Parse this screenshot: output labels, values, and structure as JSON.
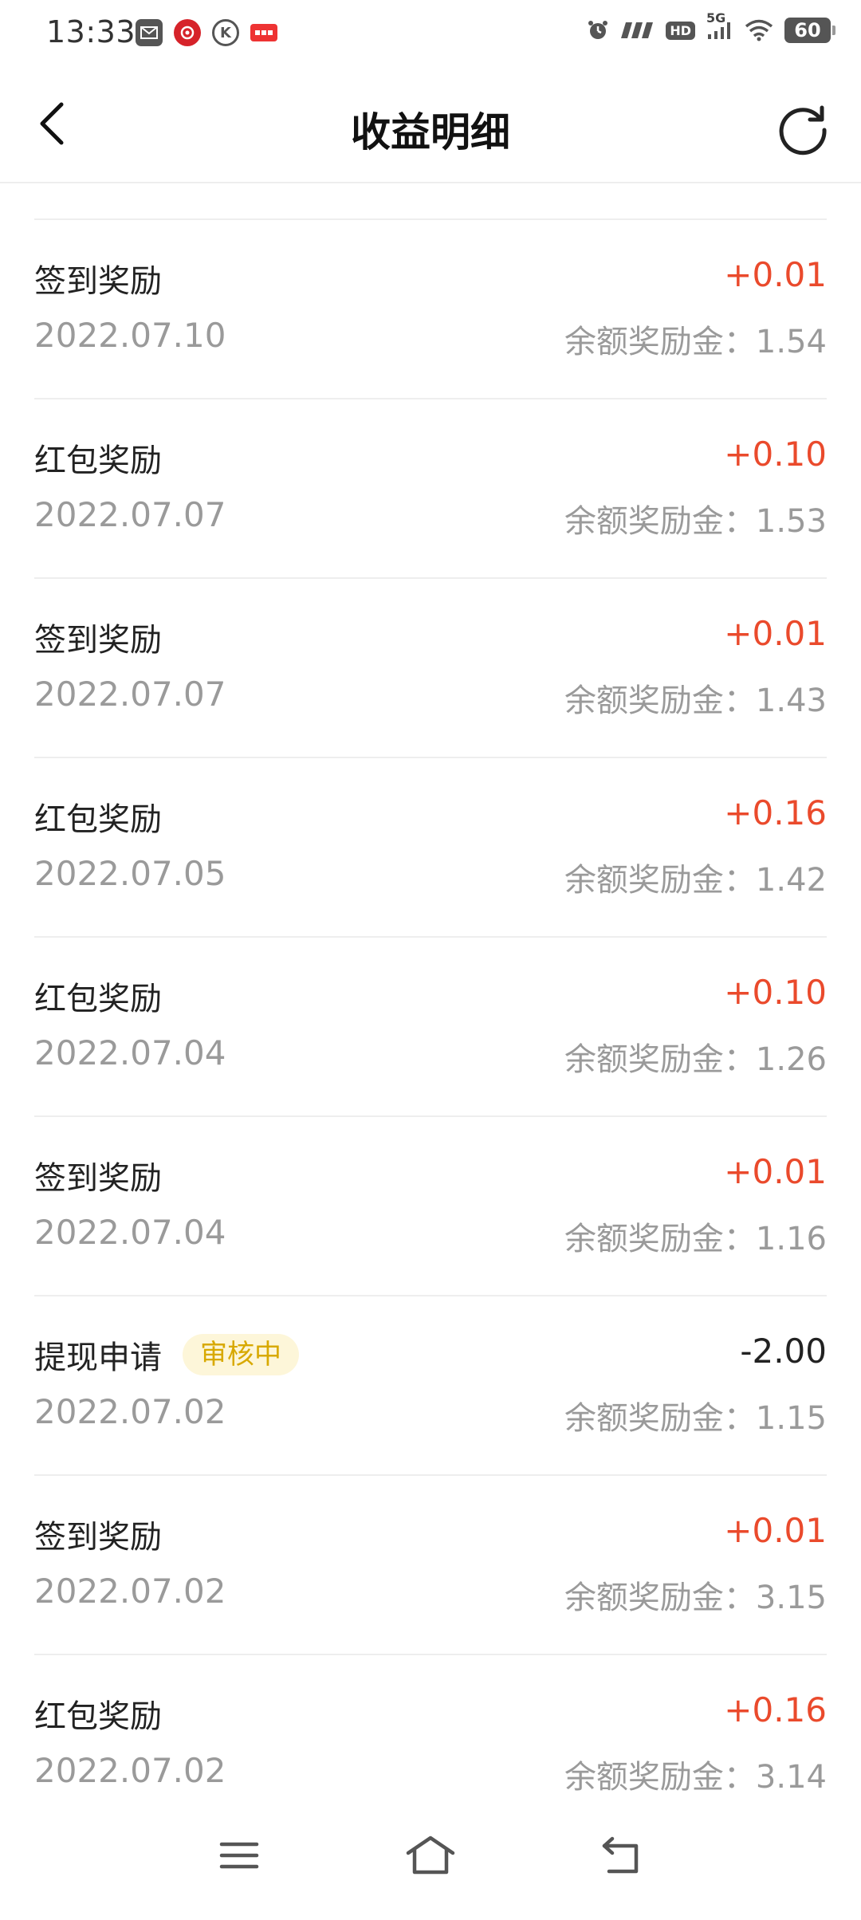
{
  "status_bar": {
    "time": "13:33",
    "battery": "60",
    "signal_label": "5G",
    "hd_label": "HD"
  },
  "header": {
    "title": "收益明细"
  },
  "items": [
    {
      "title": "签到奖励",
      "date": "2022.07.10",
      "amount": "+0.01",
      "balance": "余额奖励金：1.54",
      "badge": ""
    },
    {
      "title": "红包奖励",
      "date": "2022.07.07",
      "amount": "+0.10",
      "balance": "余额奖励金：1.53",
      "badge": ""
    },
    {
      "title": "签到奖励",
      "date": "2022.07.07",
      "amount": "+0.01",
      "balance": "余额奖励金：1.43",
      "badge": ""
    },
    {
      "title": "红包奖励",
      "date": "2022.07.05",
      "amount": "+0.16",
      "balance": "余额奖励金：1.42",
      "badge": ""
    },
    {
      "title": "红包奖励",
      "date": "2022.07.04",
      "amount": "+0.10",
      "balance": "余额奖励金：1.26",
      "badge": ""
    },
    {
      "title": "签到奖励",
      "date": "2022.07.04",
      "amount": "+0.01",
      "balance": "余额奖励金：1.16",
      "badge": ""
    },
    {
      "title": "提现申请",
      "date": "2022.07.02",
      "amount": "-2.00",
      "balance": "余额奖励金：1.15",
      "badge": "审核中"
    },
    {
      "title": "签到奖励",
      "date": "2022.07.02",
      "amount": "+0.01",
      "balance": "余额奖励金：3.15",
      "badge": ""
    },
    {
      "title": "红包奖励",
      "date": "2022.07.02",
      "amount": "+0.16",
      "balance": "余额奖励金：3.14",
      "badge": ""
    }
  ],
  "colors": {
    "positive_amount": "#ea4a2c",
    "negative_amount": "#222222",
    "badge_text": "#d8a900",
    "badge_bg": "#fdf6d9",
    "secondary_text": "#9a9a9a"
  },
  "icons": {
    "back": "chevron-left-icon",
    "refresh": "refresh-icon",
    "nav_menu": "menu-icon",
    "nav_home": "home-icon",
    "nav_back": "back-arrow-icon"
  }
}
